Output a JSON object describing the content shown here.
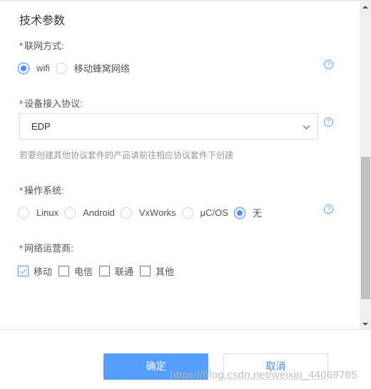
{
  "section": {
    "title": "技术参数"
  },
  "network_mode": {
    "label": "联网方式:",
    "required": true,
    "options": [
      {
        "label": "wifi",
        "checked": true
      },
      {
        "label": "移动蜂窝网络",
        "checked": false
      }
    ],
    "help_icon": "question-circle-icon"
  },
  "protocol": {
    "label": "设备接入协议:",
    "required": true,
    "selected": "EDP",
    "dropdown_icon": "chevron-down-icon",
    "hint": "若要创建其他协议套件的产品请前往相应协议套件下创建",
    "help_icon": "question-circle-icon"
  },
  "os": {
    "label": "操作系统:",
    "required": true,
    "options": [
      {
        "label": "Linux",
        "checked": false
      },
      {
        "label": "Android",
        "checked": false
      },
      {
        "label": "VxWorks",
        "checked": false
      },
      {
        "label": "μC/OS",
        "checked": false
      },
      {
        "label": "无",
        "checked": true
      }
    ],
    "help_icon": "question-circle-icon"
  },
  "carrier": {
    "label": "网络运营商:",
    "required": true,
    "options": [
      {
        "label": "移动",
        "checked": true
      },
      {
        "label": "电信",
        "checked": false
      },
      {
        "label": "联通",
        "checked": false
      },
      {
        "label": "其他",
        "checked": false
      }
    ]
  },
  "required_mark": "*",
  "help_glyph": "?",
  "footer": {
    "confirm_label": "确定",
    "cancel_label": "取消"
  },
  "watermark": "https://blog.csdn.net/weixin_44069765",
  "colors": {
    "primary": "#569fff",
    "required": "#e02020",
    "link": "#3d8bff"
  }
}
